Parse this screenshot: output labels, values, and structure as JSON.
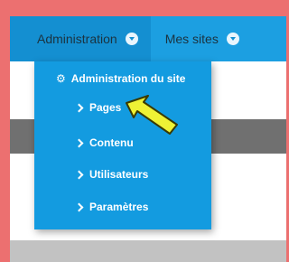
{
  "navbar": {
    "admin_label": "Administration",
    "mysites_label": "Mes sites"
  },
  "dropdown": {
    "header_label": "Administration du site",
    "header_icon": "gear-icon",
    "items": [
      {
        "label": "Pages"
      },
      {
        "label": "Contenu"
      },
      {
        "label": "Utilisateurs"
      },
      {
        "label": "Paramètres"
      }
    ]
  },
  "colors": {
    "frame": "#ec7070",
    "navbar": "#1c9fe1",
    "dropdown": "#139be0",
    "annotation_arrow": "#eef235"
  }
}
